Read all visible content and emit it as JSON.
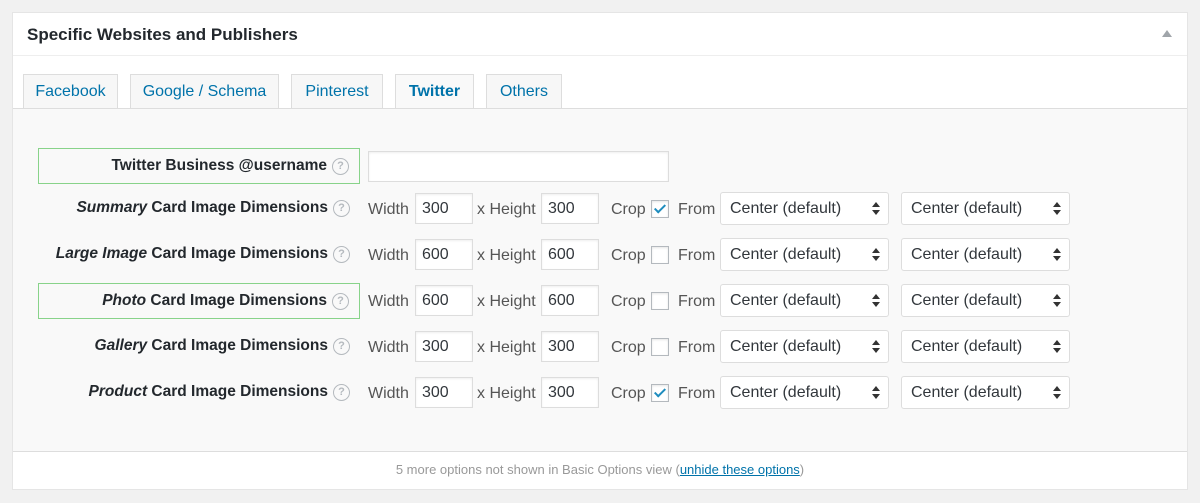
{
  "metabox": {
    "title": "Specific Websites and Publishers",
    "toggle_icon": "triangle-up-icon"
  },
  "tabs": [
    {
      "label": "Facebook"
    },
    {
      "label": "Google / Schema"
    },
    {
      "label": "Pinterest"
    },
    {
      "label": "Twitter",
      "active": true
    },
    {
      "label": "Others"
    }
  ],
  "username": {
    "label": "Twitter Business @username",
    "value": ""
  },
  "labels": {
    "width": "Width",
    "height": "x Height",
    "crop": "Crop",
    "from": "From",
    "help": "?"
  },
  "rows": [
    {
      "italic": "Summary",
      "rest": " Card Image Dimensions",
      "width": "300",
      "height": "300",
      "crop": true,
      "from_x": "Center (default)",
      "from_y": "Center (default)"
    },
    {
      "italic": "Large Image",
      "rest": " Card Image Dimensions",
      "width": "600",
      "height": "600",
      "crop": false,
      "from_x": "Center (default)",
      "from_y": "Center (default)"
    },
    {
      "italic": "Photo",
      "rest": " Card Image Dimensions",
      "width": "600",
      "height": "600",
      "crop": false,
      "from_x": "Center (default)",
      "from_y": "Center (default)"
    },
    {
      "italic": "Gallery",
      "rest": " Card Image Dimensions",
      "width": "300",
      "height": "300",
      "crop": false,
      "from_x": "Center (default)",
      "from_y": "Center (default)"
    },
    {
      "italic": "Product",
      "rest": " Card Image Dimensions",
      "width": "300",
      "height": "300",
      "crop": true,
      "from_x": "Center (default)",
      "from_y": "Center (default)"
    }
  ],
  "footer": {
    "text": "5 more options not shown in Basic Options view (",
    "link": "unhide these options",
    "close": ")"
  },
  "colors": {
    "accent": "#0073aa",
    "highlight_border": "#88d38a",
    "checkmark": "#1e8cbe"
  }
}
